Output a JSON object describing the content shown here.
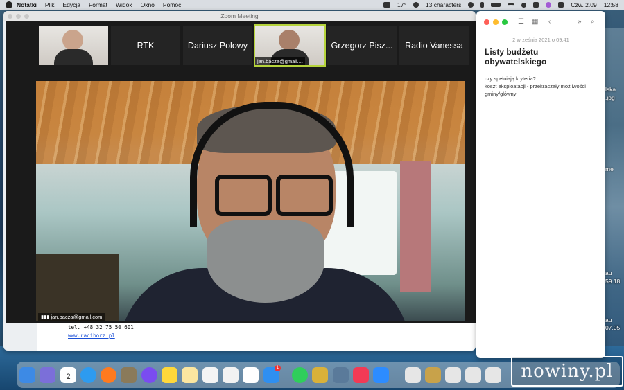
{
  "menubar": {
    "app": "Notatki",
    "items": [
      "Plik",
      "Edycja",
      "Format",
      "Widok",
      "Okno",
      "Pomoc"
    ],
    "status": {
      "temperature": "17°",
      "characters": "13 characters",
      "date": "Czw. 2.09",
      "time": "12:58"
    }
  },
  "zoom": {
    "title": "Zoom Meeting",
    "tiles": [
      {
        "label": "",
        "video": true
      },
      {
        "label": "RTK"
      },
      {
        "label": "Dariusz Polowy"
      },
      {
        "label": "",
        "video": true,
        "caption": "jan.bacza@gmail....",
        "active": true
      },
      {
        "label": "Grzegorz Pisz..."
      },
      {
        "label": "Radio Vanessa"
      }
    ],
    "speaker_caption": "jan.bacza@gmail.com",
    "document": {
      "phone": "tel. +48 32 75 50 601",
      "link": "www.raciborz.pl"
    }
  },
  "notes": {
    "date": "2 września 2021 o 09:41",
    "title": "Listy budżetu obywatelskiego",
    "lines": [
      "czy spełniają kryteria?",
      "koszt eksploatacji - przekraczały możliwości gminy/główny"
    ]
  },
  "desktop_right": [
    "lska",
    ".jpg",
    "me",
    "au",
    "59.18",
    "au",
    "07.05"
  ],
  "dock": {
    "calendar": {
      "month": "WRZ",
      "day": "2"
    },
    "mail_badge": "1"
  },
  "watermark": "nowiny.pl",
  "colors": {
    "active_tile": "#b5d33b",
    "link": "#1a4fd6"
  }
}
